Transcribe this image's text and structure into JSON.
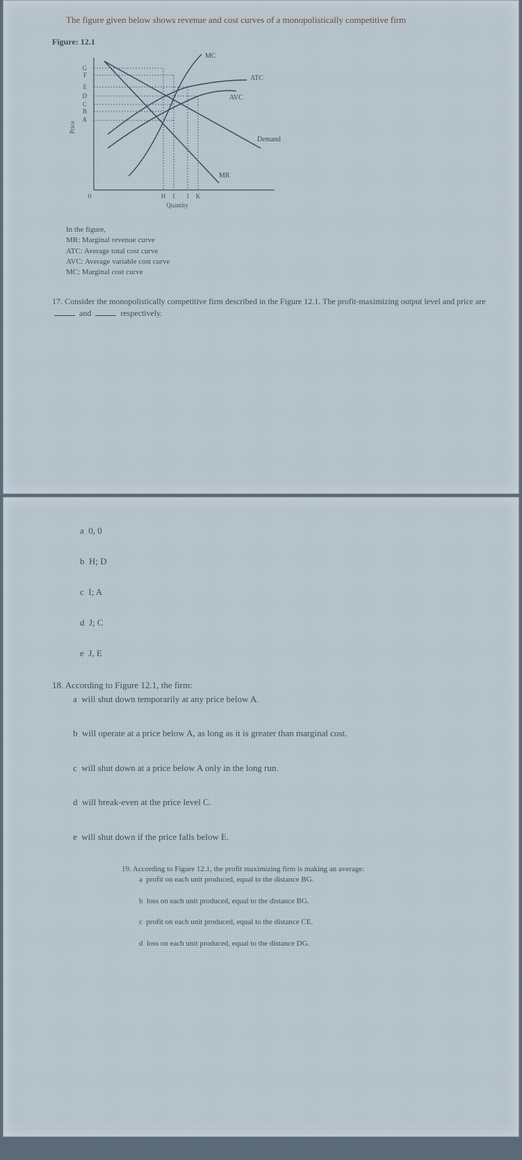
{
  "intro": "The figure given below shows revenue and cost curves of a monopolistically competitive firm",
  "figure_label": "Figure: 12.1",
  "chart_data": {
    "type": "line",
    "ylabel": "Price",
    "xlabel": "Quantity",
    "y_ticks": [
      "G",
      "F",
      "E",
      "D",
      "C",
      "B",
      "A"
    ],
    "x_ticks": [
      "H",
      "I",
      "J",
      "K"
    ],
    "origin_label": "0",
    "curves": [
      {
        "name": "MC",
        "label": "MC"
      },
      {
        "name": "ATC",
        "label": "ATC"
      },
      {
        "name": "AVC",
        "label": "AVC"
      },
      {
        "name": "Demand",
        "label": "Demand"
      },
      {
        "name": "MR",
        "label": "MR"
      }
    ]
  },
  "legend": {
    "intro": "In the figure,",
    "items": [
      "MR: Marginal revenue curve",
      "ATC: Average total cost curve",
      "AVC: Average variable cost curve",
      "MC: Marginal cost curve"
    ]
  },
  "q17": {
    "text_a": "17. Consider the monopolistically competitive firm described in the Figure 12.1. The profit-maximizing output level and price are",
    "mid": "and",
    "end": "respectively.",
    "options": [
      {
        "letter": "a",
        "text": "0, 0"
      },
      {
        "letter": "b",
        "text": "H; D"
      },
      {
        "letter": "c",
        "text": "I; A"
      },
      {
        "letter": "d",
        "text": "J; C"
      },
      {
        "letter": "e",
        "text": "J, E"
      }
    ]
  },
  "q18": {
    "stem": "18. According to Figure 12.1, the firm:",
    "options": [
      {
        "letter": "a",
        "text": "will shut down temporarily at any price below A."
      },
      {
        "letter": "b",
        "text": "will operate at a price below A, as long as it is greater than marginal cost."
      },
      {
        "letter": "c",
        "text": "will shut down at a price below A only in the long run."
      },
      {
        "letter": "d",
        "text": "will break-even at the price level C."
      },
      {
        "letter": "e",
        "text": "will shut down if the price falls below E."
      }
    ]
  },
  "q19": {
    "stem": "19. According to Figure 12.1, the profit maximizing firm is making an average:",
    "options": [
      {
        "letter": "a",
        "text": "profit on each unit produced, equal to the distance BG."
      },
      {
        "letter": "b",
        "text": "loss on each unit produced, equal to the distance BG."
      },
      {
        "letter": "c",
        "text": "profit on each unit produced, equal to the distance CE."
      },
      {
        "letter": "d",
        "text": "loss on each unit produced, equal to the distance DG."
      }
    ]
  }
}
